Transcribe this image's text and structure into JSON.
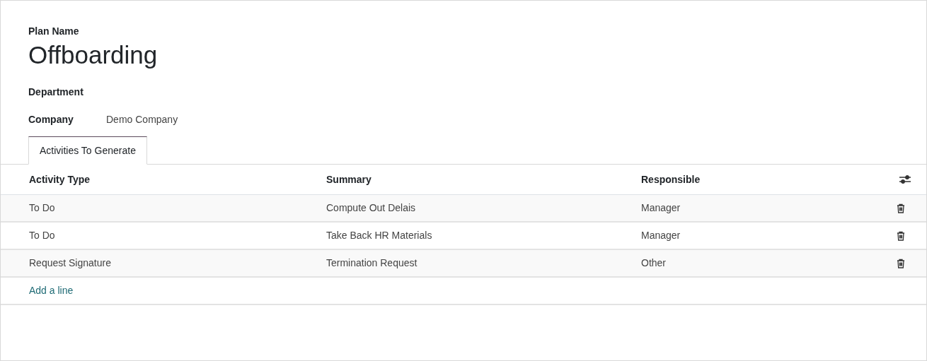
{
  "plan_name_label": "Plan Name",
  "plan_name": "Offboarding",
  "fields": [
    {
      "label": "Department"
    },
    {
      "label": "Company",
      "value": "Demo Company"
    }
  ],
  "tabs": [
    {
      "label": "Activities To Generate",
      "selected": true
    }
  ],
  "table": {
    "columns": [
      "Activity Type",
      "Summary",
      "Responsible"
    ],
    "rows": [
      [
        "To Do",
        "Compute Out Delais",
        "Manager"
      ],
      [
        "To Do",
        "Take Back HR Materials",
        "Manager"
      ],
      [
        "Request Signature",
        "Termination Request",
        "Other"
      ]
    ],
    "add_line": "Add a line"
  }
}
